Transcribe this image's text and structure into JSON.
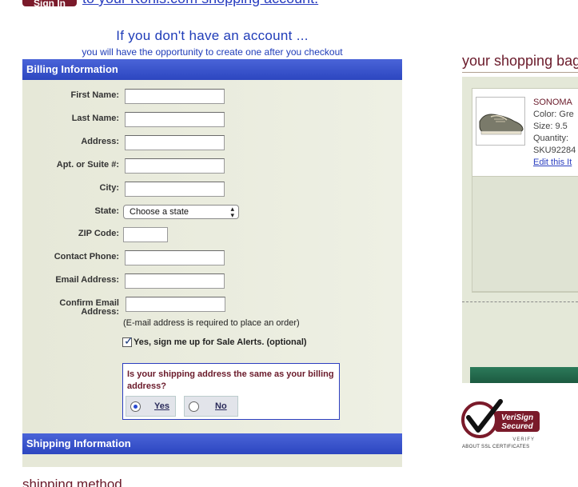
{
  "header": {
    "signin_label": "Sign In",
    "top_link": "to your Kohls.com shopping account."
  },
  "no_account": {
    "title": "If you don't have an account ...",
    "subtitle": "you will have the opportunity to create one after you checkout"
  },
  "billing": {
    "section_title": "Billing Information",
    "labels": {
      "first_name": "First Name:",
      "last_name": "Last Name:",
      "address": "Address:",
      "apt": "Apt. or Suite #:",
      "city": "City:",
      "state": "State:",
      "zip": "ZIP Code:",
      "phone": "Contact Phone:",
      "email": "Email Address:",
      "confirm_email_1": "Confirm Email",
      "confirm_email_2": "Address:"
    },
    "values": {
      "first_name": "",
      "last_name": "",
      "address": "",
      "apt": "",
      "city": "",
      "zip": "",
      "phone": "",
      "email": "",
      "confirm_email": ""
    },
    "state_selected": "Choose a state",
    "email_note": "(E-mail address is required to place an order)",
    "sale_alerts_label": "Yes, sign me up for Sale Alerts. (optional)",
    "sale_alerts_checked": true,
    "same_address_question": "Is your shipping address the same as your billing address?",
    "yes_label": "Yes",
    "no_label": "No",
    "same_address_selected": "Yes"
  },
  "shipping": {
    "section_title": "Shipping Information",
    "method_title": "shipping method"
  },
  "bag": {
    "title": "your shopping bag",
    "item": {
      "name": "SONOMA",
      "color": "Color: Gre",
      "size": "Size: 9.5",
      "quantity": "Quantity:",
      "sku": "SKU92284",
      "edit": "Edit this It"
    }
  },
  "badge": {
    "line1": "VeriSign",
    "line2": "Secured",
    "verify": "VERIFY",
    "about": "ABOUT SSL CERTIFICATES"
  },
  "colors": {
    "brand_maroon": "#6a1a2a",
    "header_blue": "#2c46c0",
    "panel_bg": "#e6e8d8",
    "bag_green": "#1c5a40"
  }
}
